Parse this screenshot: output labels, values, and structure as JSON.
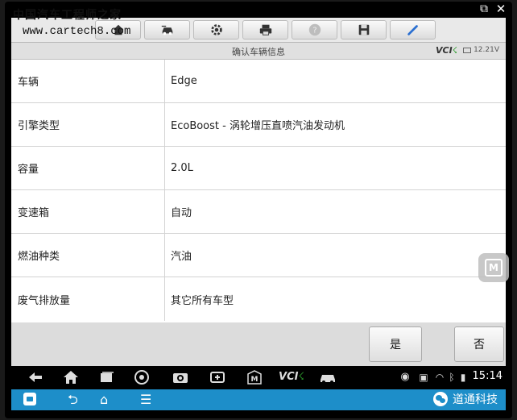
{
  "watermark": {
    "brand": "中国汽车工程师之家",
    "url": "www.cartech8.com"
  },
  "toolbar": {
    "buttons": [
      {
        "icon": "home-icon"
      },
      {
        "icon": "car-swap-icon"
      },
      {
        "icon": "gear-icon"
      },
      {
        "icon": "printer-icon"
      },
      {
        "icon": "help-icon"
      },
      {
        "icon": "save-icon"
      },
      {
        "icon": "pen-icon"
      }
    ]
  },
  "header": {
    "title": "确认车辆信息",
    "vci_label": "VCI",
    "battery": "12.21V"
  },
  "vehicle_info": [
    {
      "key": "车辆",
      "value": "Edge"
    },
    {
      "key": "引擎类型",
      "value": "EcoBoost - 涡轮增压直喷汽油发动机"
    },
    {
      "key": "容量",
      "value": "2.0L"
    },
    {
      "key": "变速箱",
      "value": "自动"
    },
    {
      "key": "燃油种类",
      "value": "汽油"
    },
    {
      "key": "废气排放量",
      "value": "其它所有车型"
    }
  ],
  "actions": {
    "yes": "是",
    "no": "否"
  },
  "status_bar": {
    "time": "15:14",
    "vci_label": "VCI"
  },
  "nav_bar": {
    "account": "道通科技"
  },
  "colors": {
    "nav_blue": "#1d8ec9",
    "vci_green": "#2a9a2a",
    "toolbar_bg": "#e9e9e9"
  }
}
